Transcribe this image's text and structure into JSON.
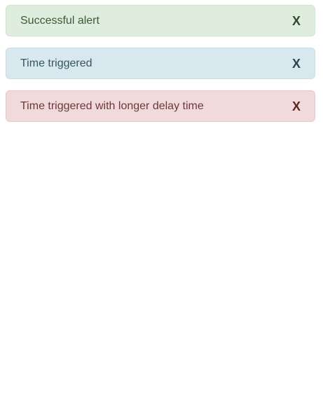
{
  "alerts": [
    {
      "message": "Successful alert",
      "close_label": "X",
      "variant": "success",
      "accent": "#dfeddf"
    },
    {
      "message": "Time triggered",
      "close_label": "X",
      "variant": "info",
      "accent": "#d9e8ee"
    },
    {
      "message": "Time triggered with longer delay time",
      "close_label": "X",
      "variant": "danger",
      "accent": "#f1dadb"
    }
  ]
}
